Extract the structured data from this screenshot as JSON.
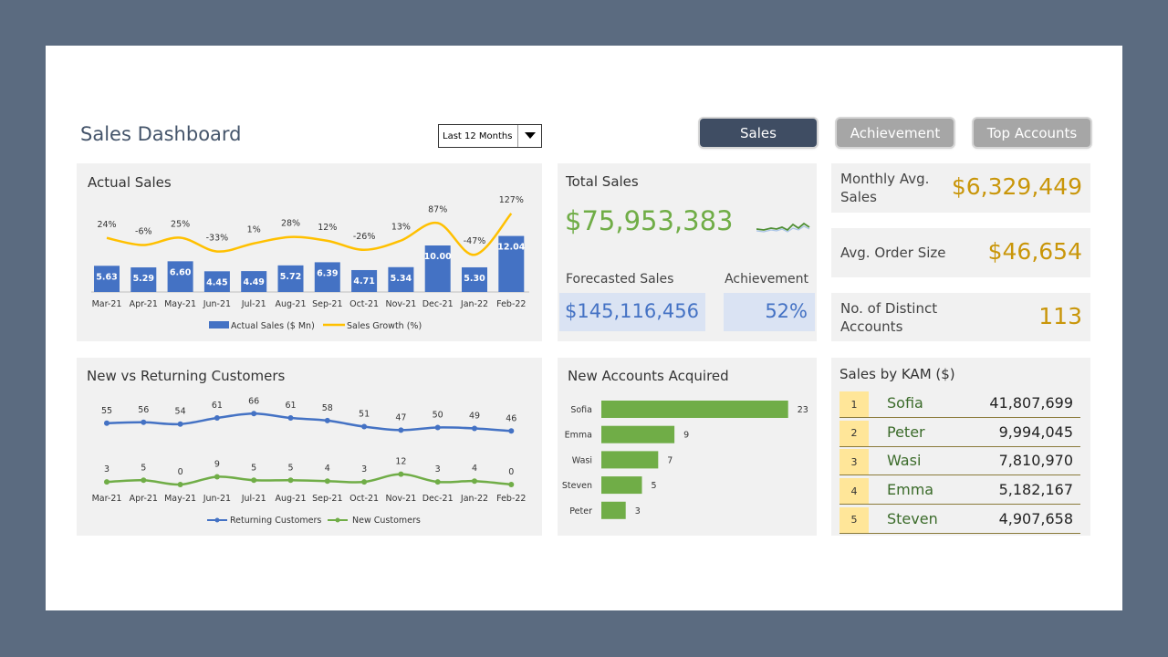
{
  "header": {
    "title": "Sales Dashboard",
    "period_select": "Last 12 Months"
  },
  "nav": {
    "sales": "Sales",
    "achievement": "Achievement",
    "top_accounts": "Top Accounts"
  },
  "colors": {
    "bar": "#4472c4",
    "growth": "#ffc000",
    "green": "#70ad47",
    "gold": "#c9960a",
    "nav_active": "#3f4d63",
    "nav_inactive": "#a6a6a6"
  },
  "total": {
    "label": "Total Sales",
    "value": "$75,953,383",
    "forecast_label": "Forecasted Sales",
    "forecast_value": "$145,116,456",
    "achievement_label": "Achievement",
    "achievement_value": "52%"
  },
  "kpis": {
    "monthly_avg_label_1": "Monthly Avg.",
    "monthly_avg_label_2": "Sales",
    "monthly_avg_value": "$6,329,449",
    "order_size_label": "Avg. Order Size",
    "order_size_value": "$46,654",
    "accounts_label_1": "No. of Distinct",
    "accounts_label_2": "Accounts",
    "accounts_value": "113"
  },
  "kam": {
    "title": "Sales by KAM ($)",
    "rows": [
      {
        "rank": "1",
        "name": "Sofia",
        "value": "41,807,699"
      },
      {
        "rank": "2",
        "name": "Peter",
        "value": "9,994,045"
      },
      {
        "rank": "3",
        "name": "Wasi",
        "value": "7,810,970"
      },
      {
        "rank": "4",
        "name": "Emma",
        "value": "5,182,167"
      },
      {
        "rank": "5",
        "name": "Steven",
        "value": "4,907,658"
      }
    ]
  },
  "chart_data": [
    {
      "type": "bar",
      "title": "Actual Sales",
      "categories": [
        "Mar-21",
        "Apr-21",
        "May-21",
        "Jun-21",
        "Jul-21",
        "Aug-21",
        "Sep-21",
        "Oct-21",
        "Nov-21",
        "Dec-21",
        "Jan-22",
        "Feb-22"
      ],
      "series": [
        {
          "name": "Actual Sales ($ Mn)",
          "type": "bar",
          "values": [
            5.63,
            5.29,
            6.6,
            4.45,
            4.49,
            5.72,
            6.39,
            4.71,
            5.34,
            10.0,
            5.3,
            12.04
          ],
          "labels": [
            "5.63",
            "5.29",
            "6.60",
            "4.45",
            "4.49",
            "5.72",
            "6.39",
            "4.71",
            "5.34",
            "10.00",
            "5.30",
            "12.04"
          ]
        },
        {
          "name": "Sales Growth (%)",
          "type": "line",
          "values": [
            24,
            -6,
            25,
            -33,
            1,
            28,
            12,
            -26,
            13,
            87,
            -47,
            127
          ],
          "labels": [
            "24%",
            "-6%",
            "25%",
            "-33%",
            "1%",
            "28%",
            "12%",
            "-26%",
            "13%",
            "87%",
            "-47%",
            "127%"
          ]
        }
      ],
      "legend": "bottom"
    },
    {
      "type": "line",
      "title": "New vs Returning Customers",
      "categories": [
        "Mar-21",
        "Apr-21",
        "May-21",
        "Jun-21",
        "Jul-21",
        "Aug-21",
        "Sep-21",
        "Oct-21",
        "Nov-21",
        "Dec-21",
        "Jan-22",
        "Feb-22"
      ],
      "series": [
        {
          "name": "Returning Customers",
          "values": [
            55,
            56,
            54,
            61,
            66,
            61,
            58,
            51,
            47,
            50,
            49,
            46
          ]
        },
        {
          "name": "New Customers",
          "values": [
            3,
            5,
            0,
            9,
            5,
            5,
            4,
            3,
            12,
            3,
            4,
            0
          ]
        }
      ],
      "legend": "bottom"
    },
    {
      "type": "bar",
      "orientation": "horizontal",
      "title": "New Accounts Acquired",
      "categories": [
        "Sofia",
        "Emma",
        "Wasi",
        "Steven",
        "Peter"
      ],
      "values": [
        23,
        9,
        7,
        5,
        3
      ]
    }
  ]
}
